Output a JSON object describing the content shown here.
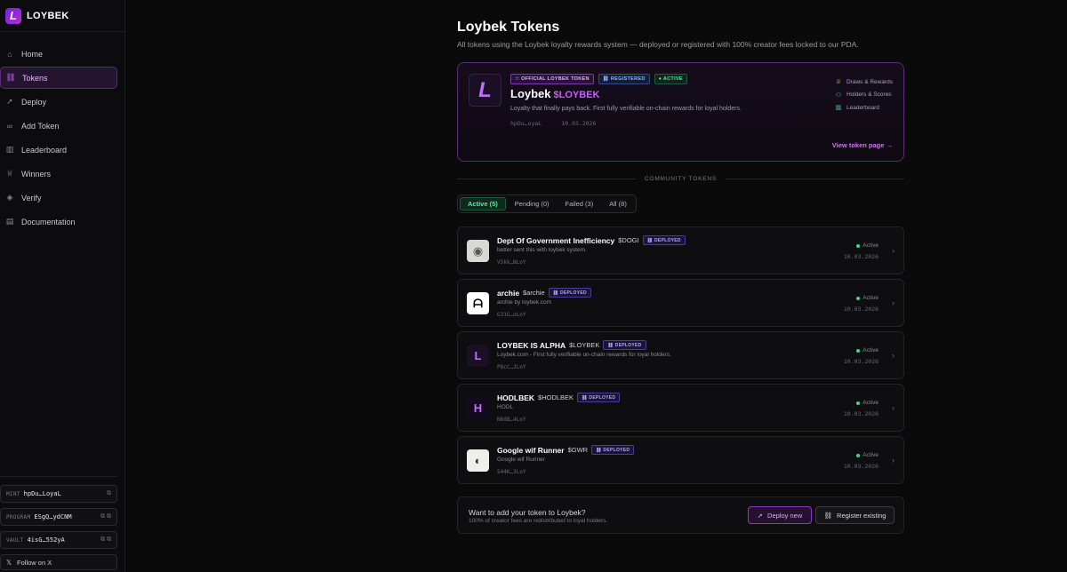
{
  "brand": {
    "name": "LOYBEK",
    "logo_letter": "L"
  },
  "sidebar": {
    "items": [
      {
        "label": "Home",
        "icon": "⌂",
        "active": false
      },
      {
        "label": "Tokens",
        "icon": "⛓",
        "active": true
      },
      {
        "label": "Deploy",
        "icon": "➚",
        "active": false
      },
      {
        "label": "Add Token",
        "icon": "∞",
        "active": false
      },
      {
        "label": "Leaderboard",
        "icon": "▥",
        "active": false
      },
      {
        "label": "Winners",
        "icon": "♕",
        "active": false
      },
      {
        "label": "Verify",
        "icon": "◈",
        "active": false
      },
      {
        "label": "Documentation",
        "icon": "▤",
        "active": false
      }
    ],
    "addresses": [
      {
        "label": "MINT",
        "value": "hpDu…LoyaL",
        "tools": "⧉"
      },
      {
        "label": "PROGRAM",
        "value": "ESgQ…ydCNM",
        "tools": "⧉ ⧉"
      },
      {
        "label": "VAULT",
        "value": "4isG…552yA",
        "tools": "⧉ ⧉"
      }
    ],
    "follow": {
      "icon": "𝕏",
      "label": "Follow on X"
    }
  },
  "page": {
    "title": "Loybek Tokens",
    "subtitle": "All tokens using the Loybek loyalty rewards system — deployed or registered with 100% creator fees locked to our PDA."
  },
  "hero": {
    "badges": {
      "official": "OFFICIAL LOYBEK TOKEN",
      "registered": "REGISTERED",
      "active": "ACTIVE"
    },
    "name": "Loybek",
    "symbol": "$LOYBEK",
    "description": "Loyalty that finally pays back. First fully verifiable on-chain rewards for loyal holders.",
    "mint": "hpDu…oyaL",
    "date": "10.03.2026",
    "links": [
      {
        "icon": "♕",
        "label": "Draws & Rewards",
        "color": "#e3b341"
      },
      {
        "icon": "⚇",
        "label": "Holders & Scores",
        "color": "#3bb6e6"
      },
      {
        "icon": "▥",
        "label": "Leaderboard",
        "color": "#3ddc84"
      }
    ],
    "view_link": "View token page →"
  },
  "divider": {
    "label": "COMMUNITY TOKENS"
  },
  "tabs": [
    {
      "label": "Active (5)",
      "active": true
    },
    {
      "label": "Pending (0)",
      "active": false
    },
    {
      "label": "Failed (3)",
      "active": false
    },
    {
      "label": "All (8)",
      "active": false
    }
  ],
  "tokens": [
    {
      "name": "Dept Of Government Inefficiency",
      "symbol": "$DOGI",
      "badge": "DEPLOYED",
      "description": "better sent this with loybek system.",
      "mint": "V5kk…NLoY",
      "status": "Active",
      "date": "10.03.2026",
      "logo": "◉",
      "logo_bg": "#d9d9d4",
      "logo_fg": "#555"
    },
    {
      "name": "archie",
      "symbol": "$archie",
      "badge": "DEPLOYED",
      "description": "archie by loybek.com",
      "mint": "G31G…oLoY",
      "status": "Active",
      "date": "10.03.2026",
      "logo": "ᗩ",
      "logo_bg": "#ffffff",
      "logo_fg": "#000"
    },
    {
      "name": "LOYBEK IS ALPHA",
      "symbol": "$LOYBEK",
      "badge": "DEPLOYED",
      "description": "Loybek.com - First fully verifiable on-chain rewards for loyal holders.",
      "mint": "P8cC…JLoY",
      "status": "Active",
      "date": "10.03.2026",
      "logo": "L",
      "logo_bg": "#1a0f24",
      "logo_fg": "#c56dff"
    },
    {
      "name": "HODLBEK",
      "symbol": "$HODLBEK",
      "badge": "DEPLOYED",
      "description": "HODL",
      "mint": "N8d8…4LoY",
      "status": "Active",
      "date": "10.03.2026",
      "logo": "H",
      "logo_bg": "#14091d",
      "logo_fg": "#c56dff"
    },
    {
      "name": "Google wif Runner",
      "symbol": "$GWR",
      "badge": "DEPLOYED",
      "description": "Google wif Runner",
      "mint": "S44K…3LoY",
      "status": "Active",
      "date": "10.03.2026",
      "logo": "◐",
      "logo_bg": "#eeeeea",
      "logo_fg": "#333"
    }
  ],
  "cta": {
    "title": "Want to add your token to Loybek?",
    "subtitle": "100% of creator fees are redistributed to loyal holders.",
    "deploy_label": "Deploy new",
    "register_label": "Register existing"
  }
}
